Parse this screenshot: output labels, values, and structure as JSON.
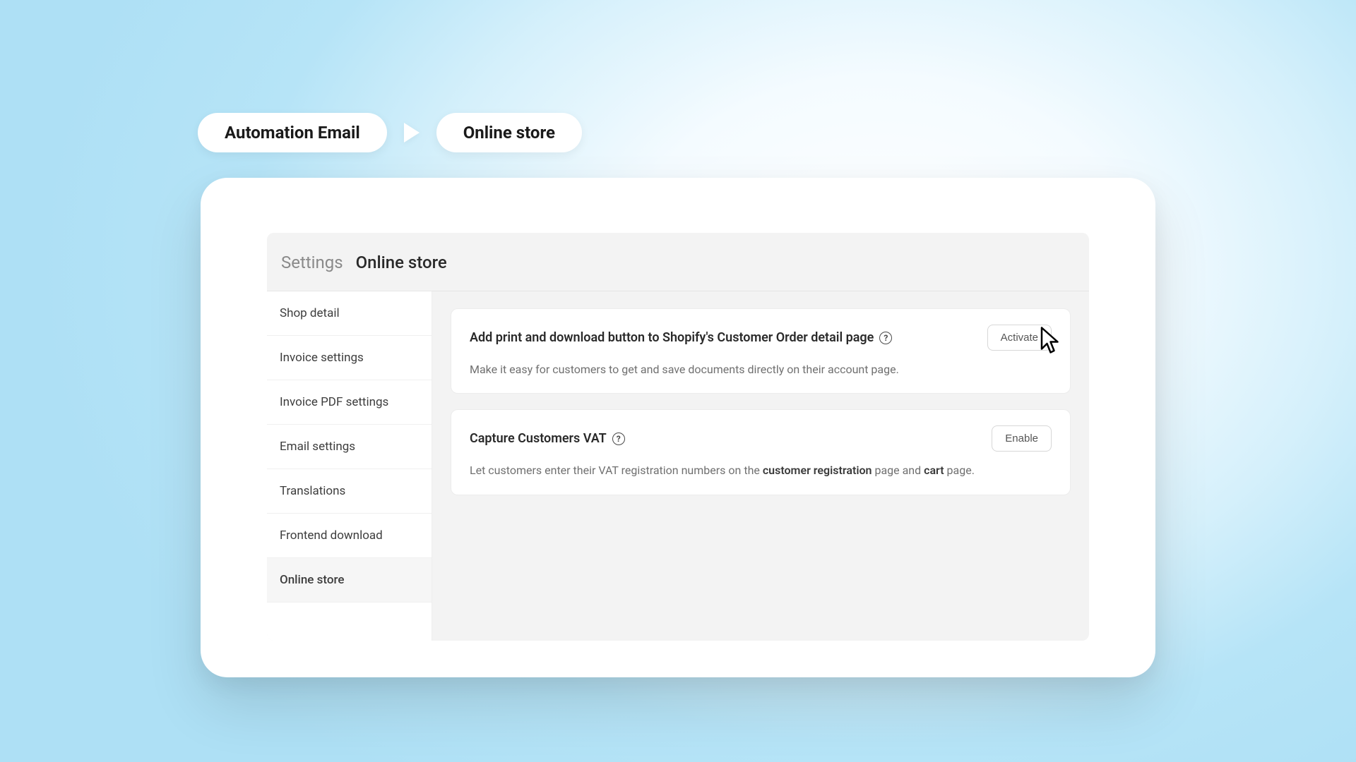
{
  "breadcrumb": {
    "prev": "Automation Email",
    "current": "Online store"
  },
  "panel": {
    "crumb_root": "Settings",
    "crumb_leaf": "Online store"
  },
  "sidebar": {
    "items": [
      {
        "label": "Shop detail"
      },
      {
        "label": "Invoice settings"
      },
      {
        "label": "Invoice PDF settings"
      },
      {
        "label": "Email settings"
      },
      {
        "label": "Translations"
      },
      {
        "label": "Frontend download"
      },
      {
        "label": "Online store"
      }
    ],
    "active_index": 6
  },
  "cards": {
    "print_download": {
      "title": "Add print and download button to Shopify's Customer Order detail page",
      "desc": "Make it easy for customers to get and save documents directly on their account page.",
      "button": "Activate"
    },
    "capture_vat": {
      "title": "Capture Customers VAT",
      "desc_pre": "Let customers enter their VAT registration numbers on the ",
      "desc_b1": "customer registration",
      "desc_mid": " page and ",
      "desc_b2": "cart",
      "desc_post": " page.",
      "button": "Enable"
    }
  }
}
